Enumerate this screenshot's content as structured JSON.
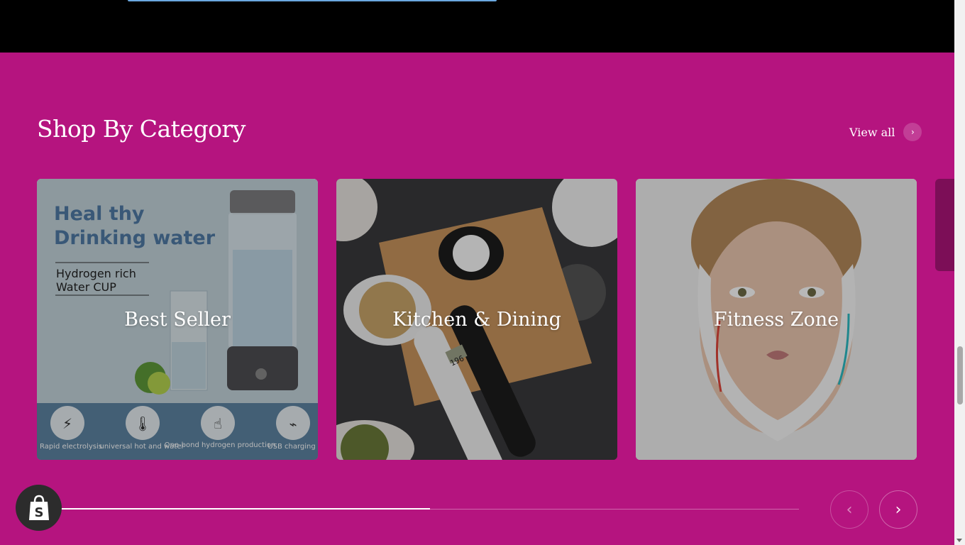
{
  "section": {
    "heading": "Shop By Category",
    "view_all_label": "View all",
    "view_all_icon": "chevron-right-icon"
  },
  "categories": [
    {
      "label": "Best Seller",
      "image": {
        "headline_line1": "Heal thy",
        "headline_line2": "Drinking water",
        "sub_line1": "Hydrogen rich",
        "sub_line2": "Water CUP",
        "features": [
          {
            "icon": "lightning-icon",
            "text": "Rapid electrolysis"
          },
          {
            "icon": "thermometer-icon",
            "text": "universal hot and water"
          },
          {
            "icon": "hand-press-icon",
            "text": "One-bond hydrogen production"
          },
          {
            "icon": "usb-icon",
            "text": "USB charging"
          }
        ]
      }
    },
    {
      "label": "Kitchen & Dining",
      "image": {
        "scale_reading": "196"
      }
    },
    {
      "label": "Fitness Zone",
      "image": {}
    }
  ],
  "slider": {
    "progress": 0.5,
    "prev_icon": "chevron-left-icon",
    "next_icon": "chevron-right-icon"
  },
  "colors": {
    "section_bg": "#b5147f",
    "top_band": "#000000",
    "text": "#ffffff"
  },
  "badge": {
    "icon": "shopify-bag-icon"
  }
}
